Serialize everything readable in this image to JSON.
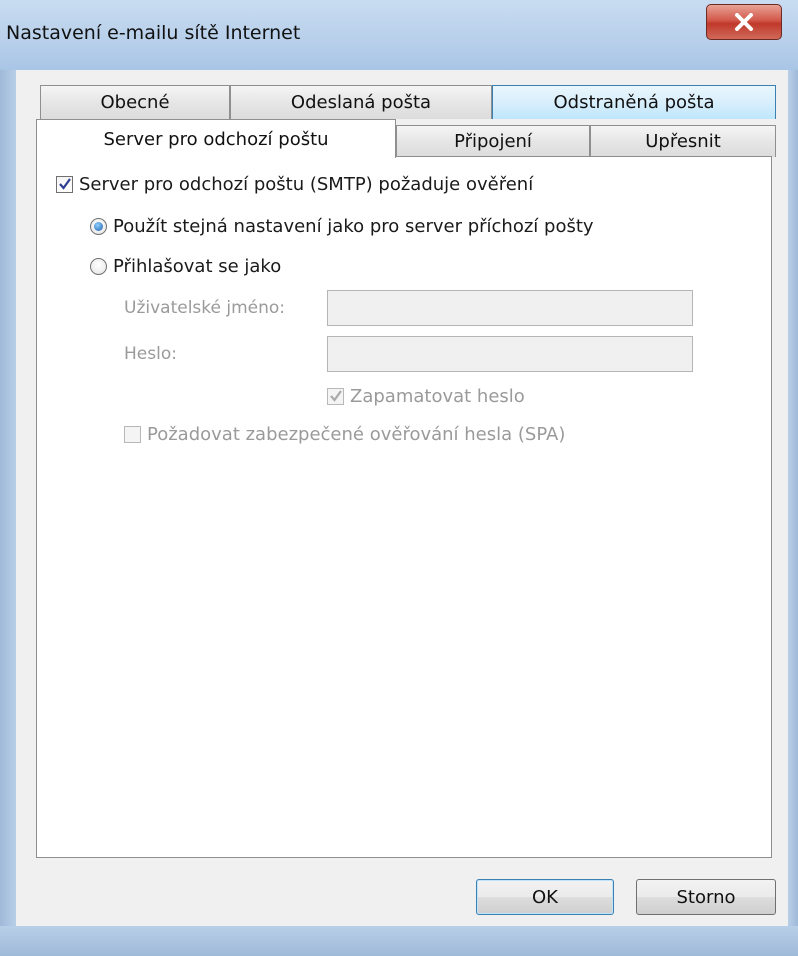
{
  "window": {
    "title": "Nastavení e-mailu sítě Internet",
    "close_icon": "close-x-icon"
  },
  "tabs": {
    "row_back": [
      {
        "label": "Obecné"
      },
      {
        "label": "Odeslaná pošta"
      },
      {
        "label": "Odstraněná pošta"
      }
    ],
    "row_front": [
      {
        "label": "Server pro odchozí poštu"
      },
      {
        "label": "Připojení"
      },
      {
        "label": "Upřesnit"
      }
    ],
    "active": "Server pro odchozí poštu"
  },
  "form": {
    "smtp_auth": {
      "label": "Server pro odchozí poštu (SMTP) požaduje ověření",
      "checked": true
    },
    "radio_same": {
      "label": "Použít stejná nastavení jako pro server příchozí pošty",
      "selected": true
    },
    "radio_login": {
      "label": "Přihlašovat se jako",
      "selected": false
    },
    "username": {
      "label": "Uživatelské jméno:",
      "value": ""
    },
    "password": {
      "label": "Heslo:",
      "value": ""
    },
    "remember": {
      "label": "Zapamatovat heslo",
      "checked": true,
      "enabled": false
    },
    "spa": {
      "label": "Požadovat zabezpečené ověřování hesla (SPA)",
      "checked": false,
      "enabled": false
    }
  },
  "buttons": {
    "ok": "OK",
    "cancel": "Storno"
  },
  "colors": {
    "accent": "#3c7fb1",
    "close": "#c0392b",
    "disabled_text": "#9a9a9a"
  }
}
